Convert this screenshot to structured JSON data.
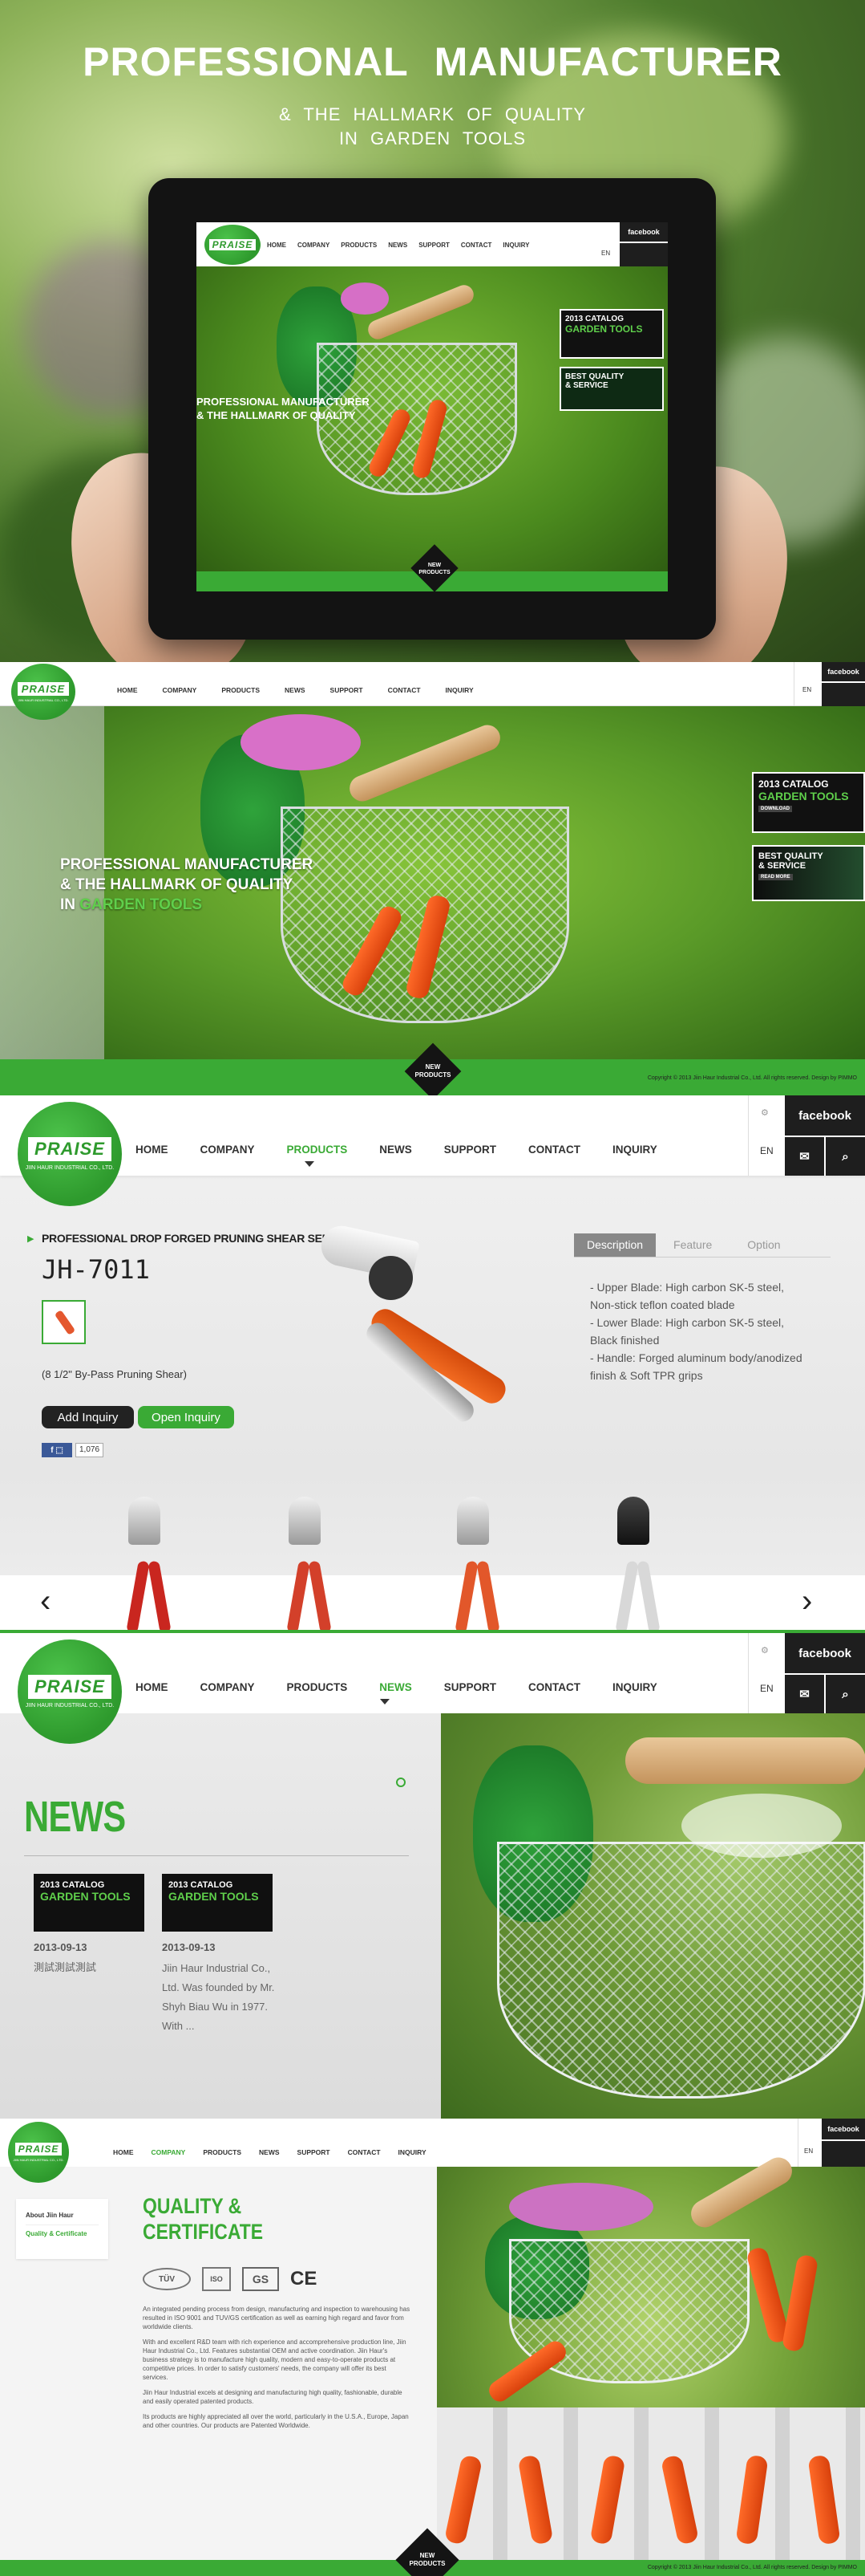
{
  "hero": {
    "title": "PROFESSIONAL   MANUFACTURER",
    "sub1": "&  THE HALLMARK  OF  QUALITY",
    "sub2": "IN   GARDEN   TOOLS"
  },
  "brand": {
    "logo": "PRAISE",
    "logo_sub": "JIIN HAUR INDUSTRIAL CO., LTD.",
    "green": "#3aaa35",
    "dark": "#1e1e1e"
  },
  "nav": [
    "HOME",
    "COMPANY",
    "PRODUCTS",
    "NEWS",
    "SUPPORT",
    "CONTACT",
    "INQUIRY"
  ],
  "facebook": "facebook",
  "lang": "EN",
  "tagline": {
    "l1": "PROFESSIONAL MANUFACTURER",
    "l2": "& THE HALLMARK OF QUALITY",
    "l3a": "IN ",
    "l3b": "GARDEN TOOLS"
  },
  "promo": {
    "catalog_year": "2013 CATALOG",
    "catalog_title": "GARDEN TOOLS",
    "download": "DOWNLOAD",
    "best1": "BEST QUALITY",
    "best2": "& SERVICE",
    "read_more": "READ MORE"
  },
  "new_products": {
    "l1": "NEW",
    "l2": "PRODUCTS"
  },
  "copyright": "Copyright © 2013 Jiin Haur Industrial Co., Ltd. All rights reserved. Design by PIMMO",
  "product": {
    "series": "PROFESSIONAL DROP FORGED PRUNING SHEAR SERIES",
    "model": "JH-7011",
    "desc": "(8 1/2\" By-Pass Pruning Shear)",
    "add_inquiry": "Add Inquiry",
    "open_inquiry": "Open Inquiry",
    "like_count": "1,076",
    "tabs": [
      "Description",
      "Feature",
      "Option"
    ],
    "details": [
      "- Upper Blade: High carbon SK-5 steel,",
      "Non-stick teflon coated blade",
      "- Lower Blade: High carbon SK-5 steel,",
      "Black finished",
      "- Handle: Forged aluminum body/anodized",
      "finish & Soft TPR grips"
    ]
  },
  "news": {
    "title": "NEWS",
    "items": [
      {
        "date": "2013-09-13",
        "text": "測試測試測試"
      },
      {
        "date": "2013-09-13",
        "text": "Jiin Haur Industrial Co., Ltd. Was founded by Mr. Shyh Biau Wu in 1977. With ..."
      }
    ]
  },
  "company": {
    "side": [
      "About Jiin Haur",
      "Quality & Certificate"
    ],
    "title1": "QUALITY &",
    "title2": "CERTIFICATE",
    "cert_labels": [
      "TÜV",
      "ISO",
      "GS",
      "CE"
    ],
    "paras": [
      "An integrated pending process from design, manufacturing and inspection to warehousing has resulted in ISO 9001 and TUV/GS certification as well as earning high regard and favor from worldwide clients.",
      "With and excellent R&D team with rich experience and accomprehensive production line, Jiin Haur Industrial Co., Ltd. Features substantial OEM and active coordination. Jiin Haur's business strategy is to manufacture high quality, modern and easy-to-operate products at competitive prices. In order to satisfy customers' needs, the company will offer its best services.",
      "Jiin Haur Industrial excels at designing and manufacturing high quality, fashionable, durable and easily operated patented products.",
      "Its products are highly appreciated all over the world, particularly in the U.S.A., Europe, Japan and other countries. Our products are Patented Worldwide."
    ]
  }
}
